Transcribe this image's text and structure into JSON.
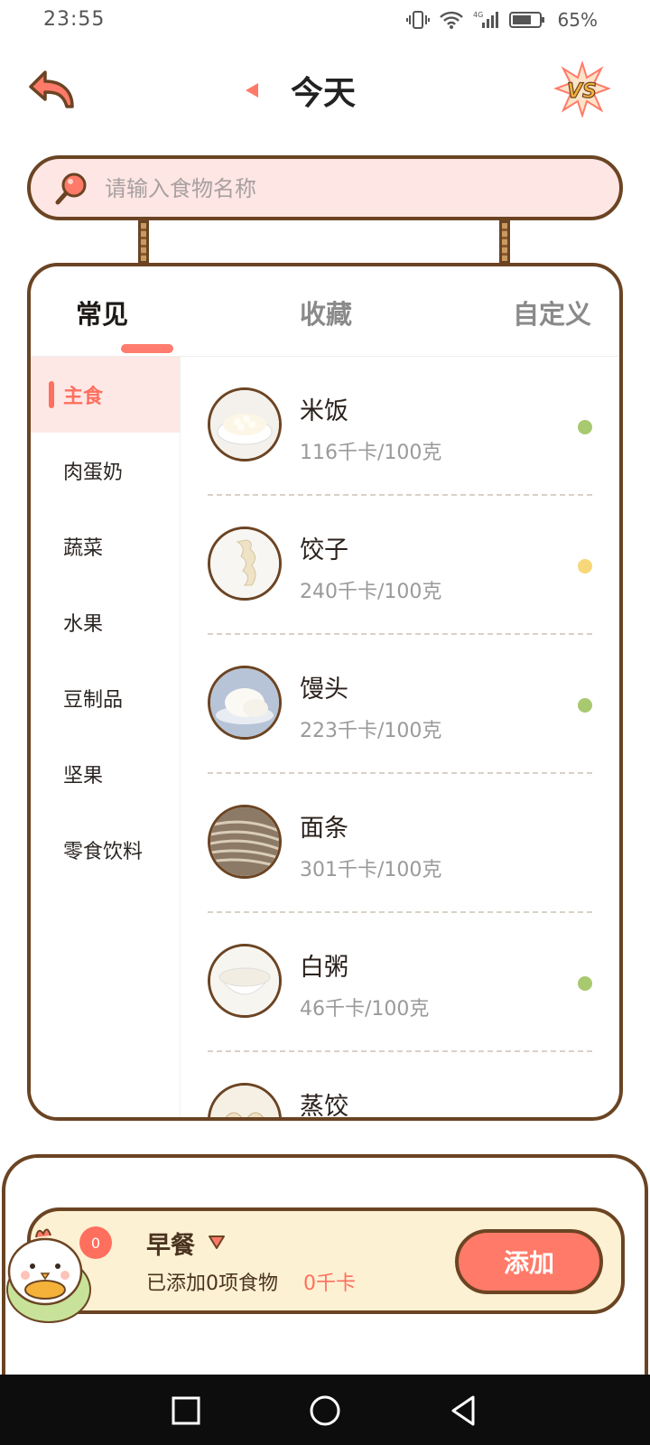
{
  "status_bar": {
    "time": "23:55",
    "network": "4G",
    "battery": "65%"
  },
  "header": {
    "title": "今天",
    "back_icon": "back-arrow-icon",
    "vs_icon": "vs-compare-icon"
  },
  "search": {
    "placeholder": "请输入食物名称"
  },
  "tabs": [
    {
      "label": "常见",
      "active": true
    },
    {
      "label": "收藏",
      "active": false
    },
    {
      "label": "自定义",
      "active": false
    }
  ],
  "categories": [
    {
      "label": "主食",
      "active": true
    },
    {
      "label": "肉蛋奶",
      "active": false
    },
    {
      "label": "蔬菜",
      "active": false
    },
    {
      "label": "水果",
      "active": false
    },
    {
      "label": "豆制品",
      "active": false
    },
    {
      "label": "坚果",
      "active": false
    },
    {
      "label": "零食饮料",
      "active": false
    }
  ],
  "foods": [
    {
      "name": "米饭",
      "calories": "116千卡/100克",
      "dot_color": "#a8c96f"
    },
    {
      "name": "饺子",
      "calories": "240千卡/100克",
      "dot_color": "#f7d77a"
    },
    {
      "name": "馒头",
      "calories": "223千卡/100克",
      "dot_color": "#a8c96f"
    },
    {
      "name": "面条",
      "calories": "301千卡/100克",
      "dot_color": ""
    },
    {
      "name": "白粥",
      "calories": "46千卡/100克",
      "dot_color": "#a8c96f"
    },
    {
      "name": "蒸饺",
      "calories": "",
      "dot_color": ""
    }
  ],
  "meal": {
    "name": "早餐",
    "summary": "已添加0项食物",
    "kcal": "0千卡",
    "count": "0",
    "add_label": "添加"
  }
}
